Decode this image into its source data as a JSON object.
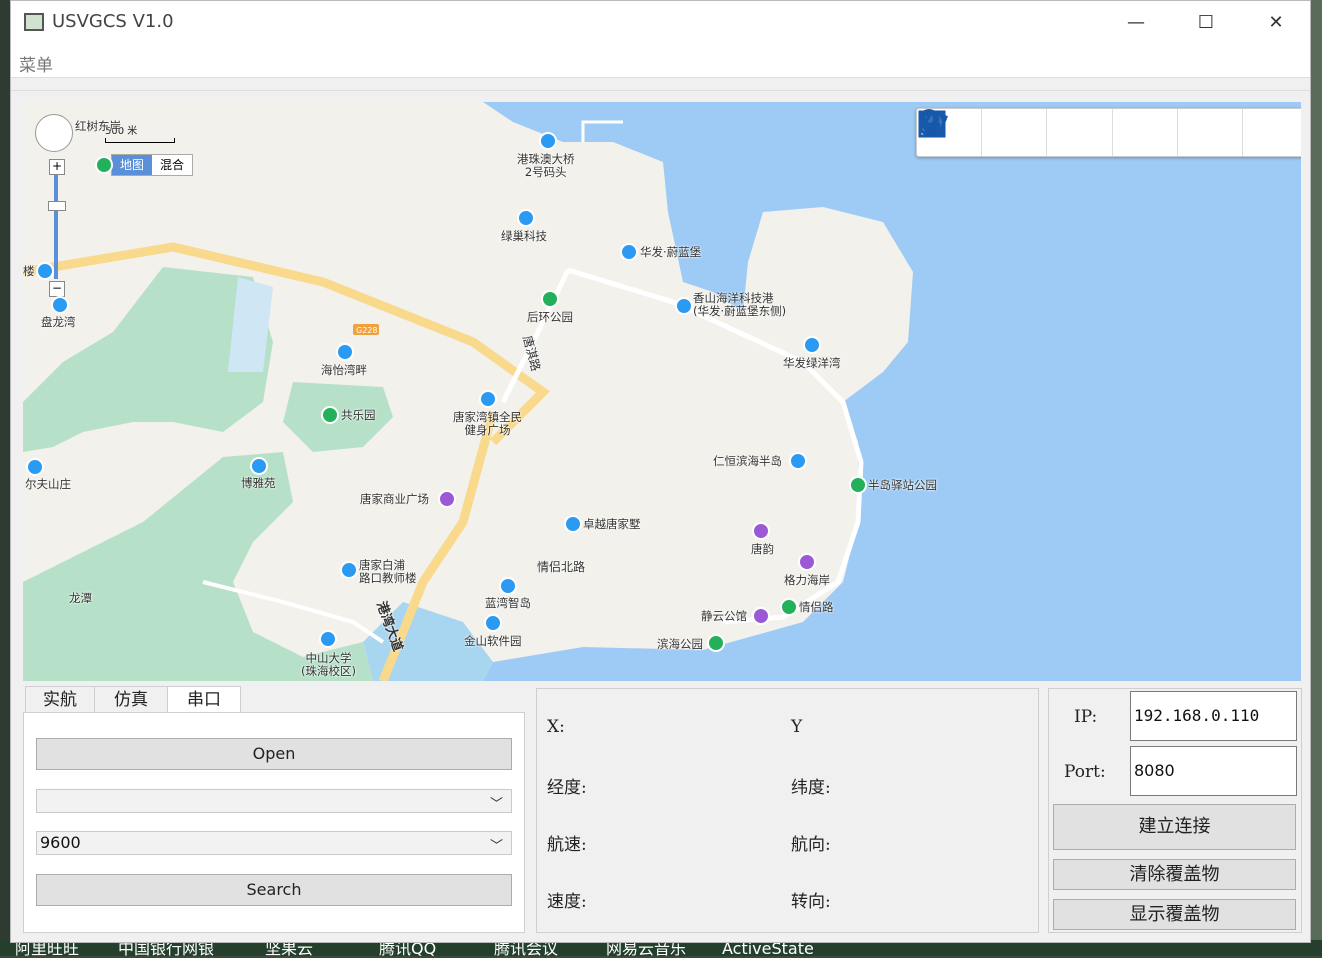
{
  "window": {
    "title": "USVGCS V1.0",
    "minimize": "—",
    "maximize": "☐",
    "close": "✕"
  },
  "menu": {
    "label": "菜单"
  },
  "taskbar": {
    "items": [
      "阿里旺旺",
      "中国银行网银",
      "坚果云",
      "腾讯QQ",
      "腾讯会议",
      "网易云音乐",
      "ActiveState"
    ]
  },
  "map": {
    "scale_label": "500 米",
    "maptype": {
      "map": "地图",
      "hybrid": "混合"
    },
    "tools": [
      "hand-pointer-icon",
      "location-pin-icon",
      "circle-icon",
      "route-icon",
      "polygon-icon",
      "rectangle-icon"
    ],
    "pois": [
      {
        "name": "红树东岸",
        "color": "green"
      },
      {
        "name": "港珠澳大桥\n2号码头",
        "color": "blue"
      },
      {
        "name": "绿巢科技",
        "color": "blue"
      },
      {
        "name": "华发·蔚蓝堡",
        "color": "blue"
      },
      {
        "name": "香山海洋科技港\n(华发·蔚蓝堡东侧)",
        "color": "blue"
      },
      {
        "name": "后环公园",
        "color": "green"
      },
      {
        "name": "华发绿洋湾",
        "color": "blue"
      },
      {
        "name": "盘龙湾",
        "color": "blue"
      },
      {
        "name": "海怡湾畔",
        "color": "blue"
      },
      {
        "name": "共乐园",
        "color": "green"
      },
      {
        "name": "唐家湾镇全民\n健身广场",
        "color": "blue"
      },
      {
        "name": "仁恒滨海半岛",
        "color": "blue"
      },
      {
        "name": "半岛驿站公园",
        "color": "green"
      },
      {
        "name": "尔夫山庄",
        "color": "blue"
      },
      {
        "name": "博雅苑",
        "color": "blue"
      },
      {
        "name": "唐家商业广场",
        "color": "purple"
      },
      {
        "name": "卓越唐家墅",
        "color": "blue"
      },
      {
        "name": "唐韵",
        "color": "purple"
      },
      {
        "name": "格力海岸",
        "color": "purple"
      },
      {
        "name": "唐家白浦\n路口教师楼",
        "color": "blue"
      },
      {
        "name": "情侣北路",
        "color": "none"
      },
      {
        "name": "蓝湾智岛",
        "color": "blue"
      },
      {
        "name": "静云公馆",
        "color": "purple"
      },
      {
        "name": "情侣路",
        "color": "green"
      },
      {
        "name": "金山软件园",
        "color": "blue"
      },
      {
        "name": "滨海公园",
        "color": "green"
      },
      {
        "name": "中山大学\n(珠海校区)",
        "color": "blue"
      },
      {
        "name": "龙潭",
        "color": "none"
      },
      {
        "name": "唐淇路",
        "color": "none"
      },
      {
        "name": "港湾大道",
        "color": "none"
      },
      {
        "name": "G228",
        "color": "none"
      },
      {
        "name": "楼",
        "color": "blue"
      }
    ]
  },
  "tabs": [
    {
      "label": "实航"
    },
    {
      "label": "仿真"
    },
    {
      "label": "串口"
    }
  ],
  "serial": {
    "open_label": "Open",
    "port_value": "",
    "baud_value": "9600",
    "search_label": "Search"
  },
  "telemetry": {
    "x_label": "X:",
    "y_label": "Y",
    "lon_label": "经度:",
    "lat_label": "纬度:",
    "speed_label": "航速:",
    "heading_label": "航向:",
    "velocity_label": "速度:",
    "turn_label": "转向:"
  },
  "network": {
    "ip_label": "IP:",
    "ip_value": "192.168.0.110",
    "port_label": "Port:",
    "port_value": "8080",
    "connect_label": "建立连接",
    "clear_label": "清除覆盖物",
    "show_label": "显示覆盖物"
  }
}
